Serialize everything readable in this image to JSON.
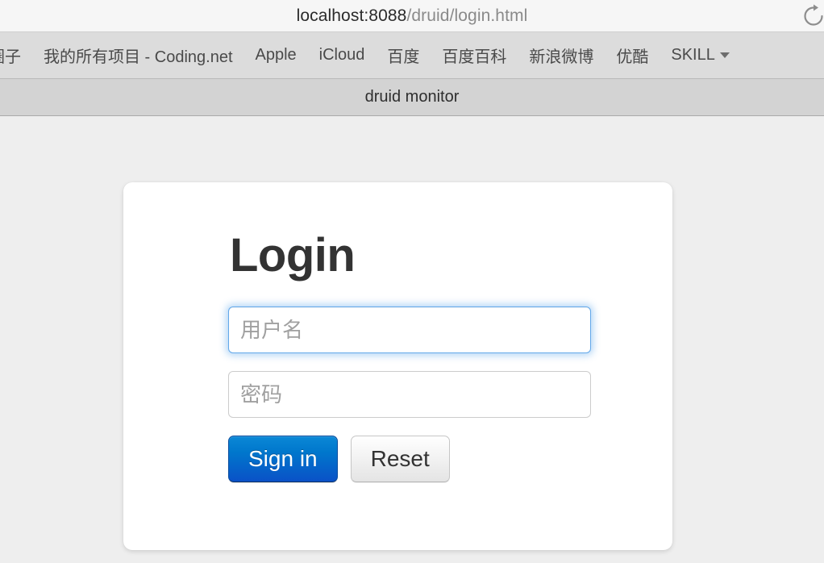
{
  "browser": {
    "url": {
      "host": "localhost:8088",
      "path": "/druid/login.html"
    },
    "reload_icon": "reload-icon",
    "bookmarks": [
      {
        "label": "圈子"
      },
      {
        "label": "我的所有项目 - Coding.net"
      },
      {
        "label": "Apple"
      },
      {
        "label": "iCloud"
      },
      {
        "label": "百度"
      },
      {
        "label": "百度百科"
      },
      {
        "label": "新浪微博"
      },
      {
        "label": "优酷"
      },
      {
        "label": "SKILL"
      }
    ],
    "tab_title": "druid monitor"
  },
  "login": {
    "title": "Login",
    "username": {
      "placeholder": "用户名",
      "value": "",
      "focused": true
    },
    "password": {
      "placeholder": "密码",
      "value": "",
      "focused": false
    },
    "sign_in_label": "Sign in",
    "reset_label": "Reset"
  },
  "colors": {
    "page_background": "#eeeeee",
    "card_background": "#ffffff",
    "primary_button": "#0077cc",
    "focus_border": "#62a8ea",
    "title_text": "#333333"
  }
}
